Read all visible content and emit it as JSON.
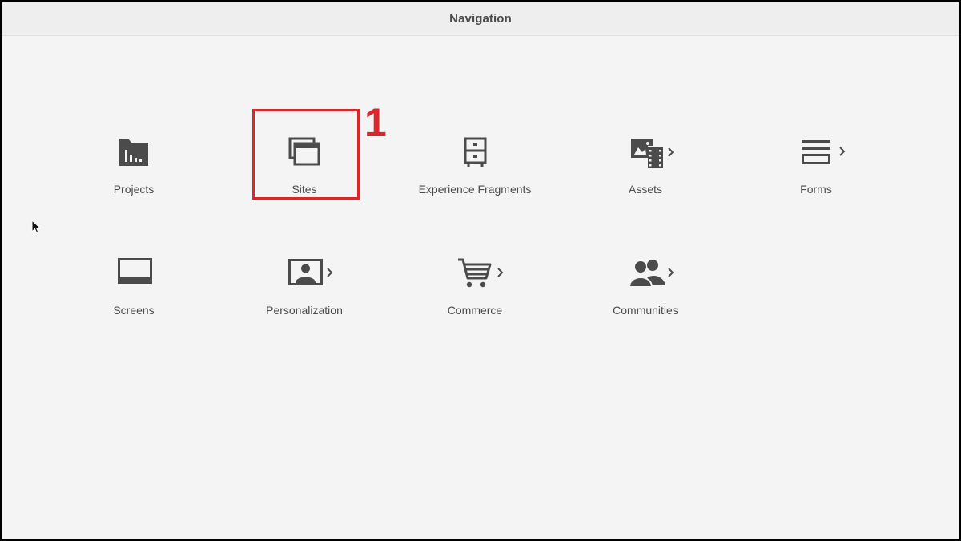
{
  "header": {
    "title": "Navigation"
  },
  "tiles": [
    {
      "label": "Projects",
      "icon": "projects-folder-icon",
      "has_submenu": false
    },
    {
      "label": "Sites",
      "icon": "sites-windows-icon",
      "has_submenu": false
    },
    {
      "label": "Experience Fragments",
      "icon": "experience-fragments-cabinet-icon",
      "has_submenu": false
    },
    {
      "label": "Assets",
      "icon": "assets-image-film-icon",
      "has_submenu": true
    },
    {
      "label": "Forms",
      "icon": "forms-lines-icon",
      "has_submenu": true
    },
    {
      "label": "Screens",
      "icon": "screens-display-icon",
      "has_submenu": false
    },
    {
      "label": "Personalization",
      "icon": "personalization-portrait-icon",
      "has_submenu": true
    },
    {
      "label": "Commerce",
      "icon": "commerce-cart-icon",
      "has_submenu": true
    },
    {
      "label": "Communities",
      "icon": "communities-people-icon",
      "has_submenu": true
    }
  ],
  "annotation": {
    "number": "1",
    "target": "Sites"
  },
  "colors": {
    "icon": "#4b4b4b",
    "background": "#f4f4f4",
    "header_background": "#eeeeee",
    "annotation": "#d9272e"
  }
}
